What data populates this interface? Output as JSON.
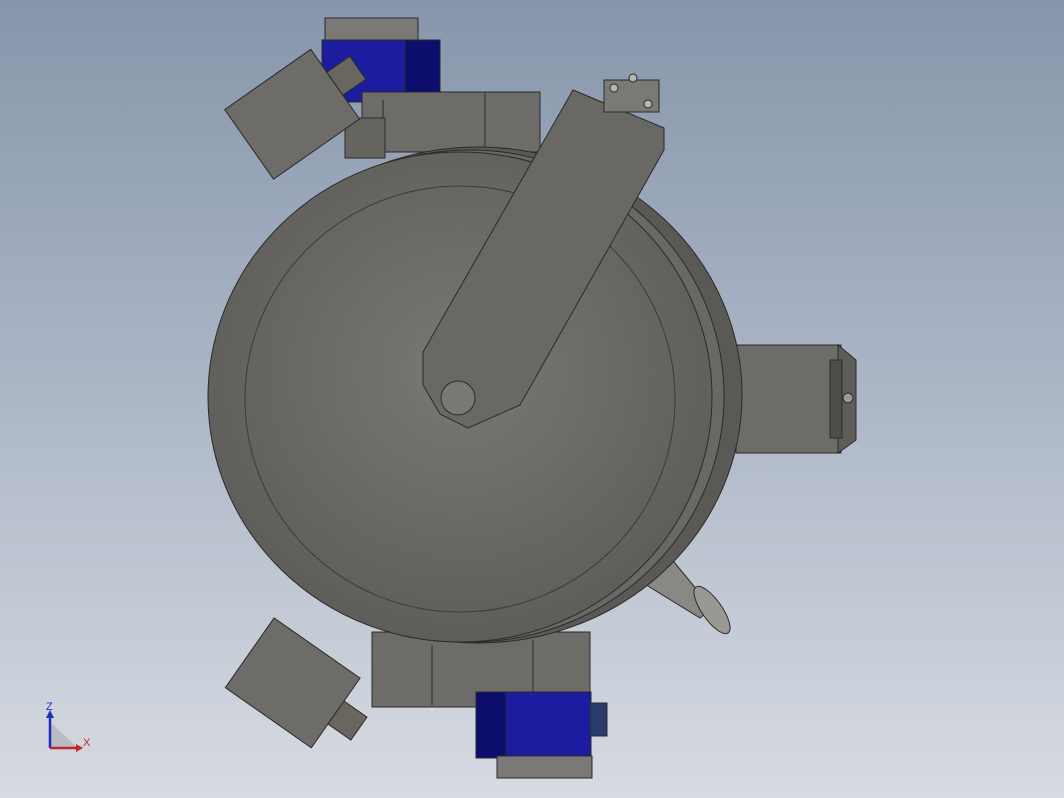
{
  "viewport": {
    "background_top": "#8796ab",
    "background_bottom": "#d7dbe2"
  },
  "model": {
    "body_color": "#6e6c68",
    "edge_color": "#2a2a2a",
    "motor_color": "#1c1ca0",
    "motor_dark": "#0d0d6e"
  },
  "triad": {
    "z_label": "Z",
    "x_label": "X",
    "z_color": "#1a2dbf",
    "x_color": "#c0282c"
  }
}
